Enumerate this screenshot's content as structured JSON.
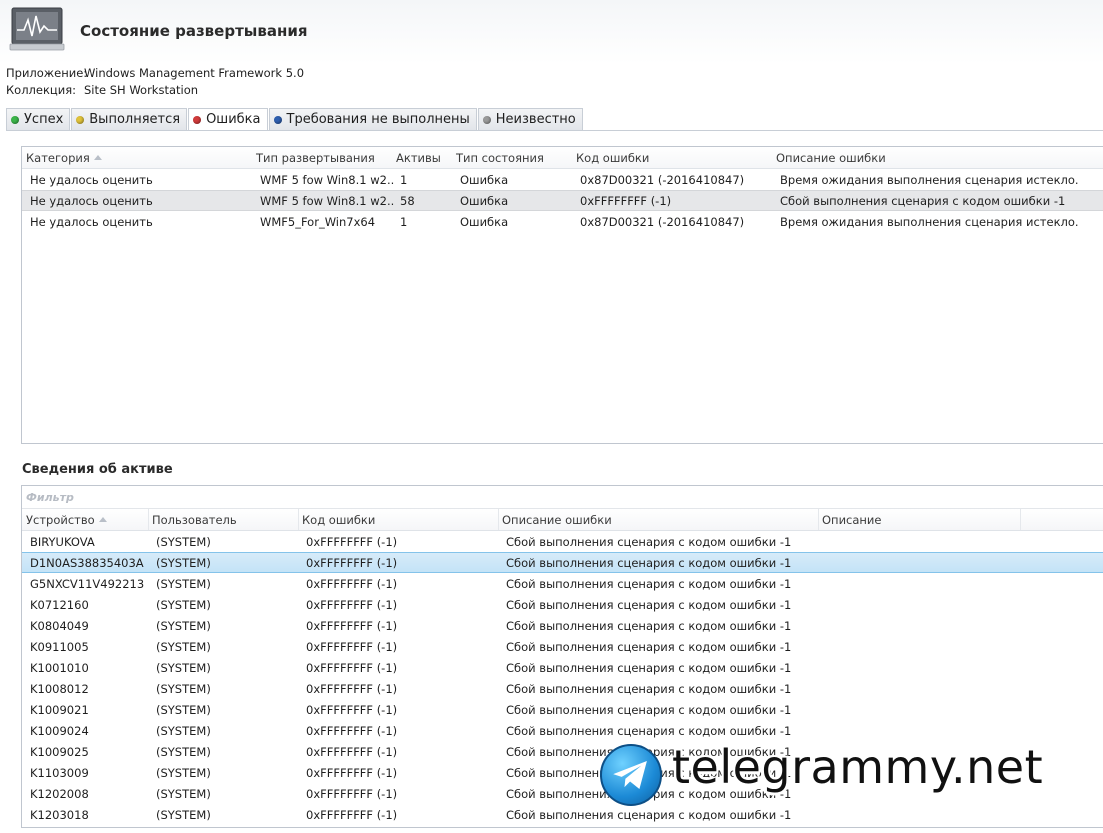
{
  "header": {
    "title": "Состояние развертывания",
    "icon": "monitor-activity-icon"
  },
  "meta": {
    "app_label": "Приложение:",
    "app_value": "Windows Management Framework 5.0",
    "collection_label": "Коллекция:",
    "collection_value": "Site SH Workstation"
  },
  "tabs": [
    {
      "label": "Успех",
      "color": "#3cb64a"
    },
    {
      "label": "Выполняется",
      "color": "#e0c23a"
    },
    {
      "label": "Ошибка",
      "color": "#d23b3b",
      "active": true
    },
    {
      "label": "Требования не выполнены",
      "color": "#2f5fb0"
    },
    {
      "label": "Неизвестно",
      "color": "#9a9a9a"
    }
  ],
  "top_table": {
    "columns": [
      "Категория",
      "Тип развертывания",
      "Активы",
      "Тип состояния",
      "Код ошибки",
      "Описание ошибки"
    ],
    "rows": [
      [
        "Не удалось оценить",
        "WMF 5 fow Win8.1 w2...",
        "1",
        "Ошибка",
        "0x87D00321 (-2016410847)",
        "Время ожидания выполнения сценария истекло."
      ],
      [
        "Не удалось оценить",
        "WMF 5 fow Win8.1 w2...",
        "58",
        "Ошибка",
        "0xFFFFFFFF (-1)",
        "Сбой выполнения сценария с кодом ошибки -1"
      ],
      [
        "Не удалось оценить",
        "WMF5_For_Win7x64",
        "1",
        "Ошибка",
        "0x87D00321 (-2016410847)",
        "Время ожидания выполнения сценария истекло."
      ]
    ]
  },
  "assets": {
    "title": "Сведения об активе",
    "filter_placeholder": "Фильтр",
    "columns": [
      "Устройство",
      "Пользователь",
      "Код ошибки",
      "Описание ошибки",
      "Описание"
    ],
    "rows": [
      [
        "BIRYUKOVA",
        "(SYSTEM)",
        "0xFFFFFFFF (-1)",
        "Сбой выполнения сценария с кодом ошибки -1",
        ""
      ],
      [
        "D1N0AS38835403A",
        "(SYSTEM)",
        "0xFFFFFFFF (-1)",
        "Сбой выполнения сценария с кодом ошибки -1",
        ""
      ],
      [
        "G5NXCV11V492213",
        "(SYSTEM)",
        "0xFFFFFFFF (-1)",
        "Сбой выполнения сценария с кодом ошибки -1",
        ""
      ],
      [
        "K0712160",
        "(SYSTEM)",
        "0xFFFFFFFF (-1)",
        "Сбой выполнения сценария с кодом ошибки -1",
        ""
      ],
      [
        "K0804049",
        "(SYSTEM)",
        "0xFFFFFFFF (-1)",
        "Сбой выполнения сценария с кодом ошибки -1",
        ""
      ],
      [
        "K0911005",
        "(SYSTEM)",
        "0xFFFFFFFF (-1)",
        "Сбой выполнения сценария с кодом ошибки -1",
        ""
      ],
      [
        "K1001010",
        "(SYSTEM)",
        "0xFFFFFFFF (-1)",
        "Сбой выполнения сценария с кодом ошибки -1",
        ""
      ],
      [
        "K1008012",
        "(SYSTEM)",
        "0xFFFFFFFF (-1)",
        "Сбой выполнения сценария с кодом ошибки -1",
        ""
      ],
      [
        "K1009021",
        "(SYSTEM)",
        "0xFFFFFFFF (-1)",
        "Сбой выполнения сценария с кодом ошибки -1",
        ""
      ],
      [
        "K1009024",
        "(SYSTEM)",
        "0xFFFFFFFF (-1)",
        "Сбой выполнения сценария с кодом ошибки -1",
        ""
      ],
      [
        "K1009025",
        "(SYSTEM)",
        "0xFFFFFFFF (-1)",
        "Сбой выполнения сценария с кодом ошибки -1",
        ""
      ],
      [
        "K1103009",
        "(SYSTEM)",
        "0xFFFFFFFF (-1)",
        "Сбой выполнения сценария с кодом ошибки -1",
        ""
      ],
      [
        "K1202008",
        "(SYSTEM)",
        "0xFFFFFFFF (-1)",
        "Сбой выполнения сценария с кодом ошибки -1",
        ""
      ],
      [
        "K1203018",
        "(SYSTEM)",
        "0xFFFFFFFF (-1)",
        "Сбой выполнения сценария с кодом ошибки -1",
        ""
      ]
    ]
  },
  "watermark": {
    "text": "telegrammy.net",
    "icon": "telegram-plane-icon"
  }
}
